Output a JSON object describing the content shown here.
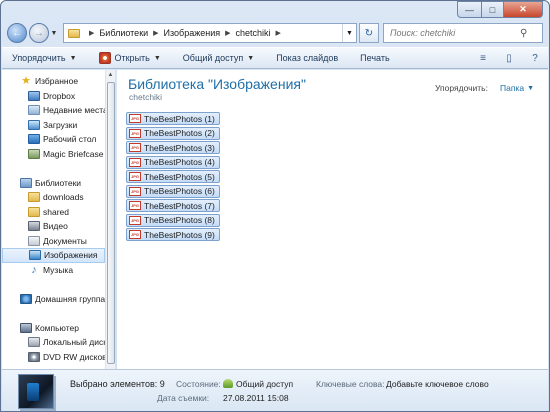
{
  "window": {
    "caption": {
      "minimize": "—",
      "maximize": "□",
      "close": "✕"
    }
  },
  "address": {
    "back": "←",
    "forward": "→",
    "dropdown": "▼",
    "crumbs": [
      "Библиотеки",
      "Изображения",
      "chetchiki"
    ],
    "refresh": "↻",
    "search_placeholder": "Поиск: chetchiki",
    "search_icon": "search-icon"
  },
  "toolbar": {
    "organize": "Упорядочить",
    "open": "Открыть",
    "share": "Общий доступ",
    "slideshow": "Показ слайдов",
    "print": "Печать",
    "dropdown": "▼",
    "view_icon": "≡",
    "pane_icon": "▯",
    "help_icon": "?"
  },
  "navpane": {
    "favorites": {
      "label": "Избранное",
      "items": [
        "Dropbox",
        "Недавние места",
        "Загрузки",
        "Рабочий стол",
        "Magic Briefcase"
      ]
    },
    "libraries": {
      "label": "Библиотеки",
      "items": [
        "downloads",
        "shared",
        "Видео",
        "Документы",
        "Изображения",
        "Музыка"
      ]
    },
    "homegroup": "Домашняя группа",
    "computer": {
      "label": "Компьютер",
      "items": [
        "Локальный диск",
        "DVD RW дисково"
      ]
    }
  },
  "content": {
    "title": "Библиотека \"Изображения\"",
    "subtitle": "chetchiki",
    "arrange_label": "Упорядочить:",
    "arrange_value": "Папка",
    "file_badge": "JPG",
    "files": [
      "TheBestPhotos (1)",
      "TheBestPhotos (2)",
      "TheBestPhotos (3)",
      "TheBestPhotos (4)",
      "TheBestPhotos (5)",
      "TheBestPhotos (6)",
      "TheBestPhotos (7)",
      "TheBestPhotos (8)",
      "TheBestPhotos (9)"
    ]
  },
  "details": {
    "selected": "Выбрано элементов: 9",
    "state_label": "Состояние:",
    "state_value": "Общий доступ",
    "keywords_label": "Ключевые слова:",
    "keywords_value": "Добавьте ключевое слово",
    "date_label": "Дата съемки:",
    "date_value": "27.08.2011 15:08"
  },
  "colors": {
    "accent": "#1e6fa9",
    "selection": "#c4dcf7",
    "chrome": "#dbe7f5"
  }
}
